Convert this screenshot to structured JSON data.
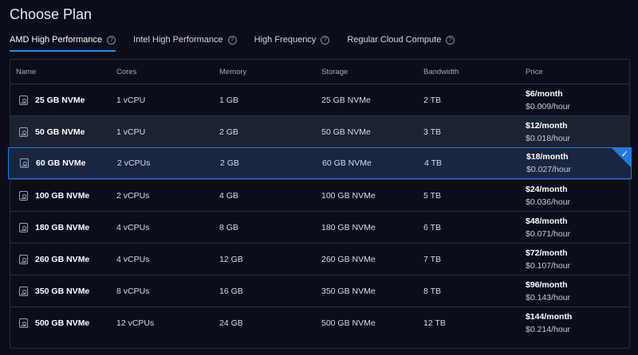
{
  "page_title": "Choose Plan",
  "tabs": [
    {
      "label": "AMD High Performance",
      "active": true
    },
    {
      "label": "Intel High Performance",
      "active": false
    },
    {
      "label": "High Frequency",
      "active": false
    },
    {
      "label": "Regular Cloud Compute",
      "active": false
    }
  ],
  "help_glyph": "?",
  "columns": {
    "name": "Name",
    "cores": "Cores",
    "memory": "Memory",
    "storage": "Storage",
    "bandwidth": "Bandwidth",
    "price": "Price"
  },
  "plans": [
    {
      "name": "25 GB NVMe",
      "cores": "1 vCPU",
      "memory": "1 GB",
      "storage": "25 GB NVMe",
      "bandwidth": "2 TB",
      "price_month": "$6/month",
      "price_hour": "$0.009/hour"
    },
    {
      "name": "50 GB NVMe",
      "cores": "1 vCPU",
      "memory": "2 GB",
      "storage": "50 GB NVMe",
      "bandwidth": "3 TB",
      "price_month": "$12/month",
      "price_hour": "$0.018/hour"
    },
    {
      "name": "60 GB NVMe",
      "cores": "2 vCPUs",
      "memory": "2 GB",
      "storage": "60 GB NVMe",
      "bandwidth": "4 TB",
      "price_month": "$18/month",
      "price_hour": "$0.027/hour"
    },
    {
      "name": "100 GB NVMe",
      "cores": "2 vCPUs",
      "memory": "4 GB",
      "storage": "100 GB NVMe",
      "bandwidth": "5 TB",
      "price_month": "$24/month",
      "price_hour": "$0.036/hour"
    },
    {
      "name": "180 GB NVMe",
      "cores": "4 vCPUs",
      "memory": "8 GB",
      "storage": "180 GB NVMe",
      "bandwidth": "6 TB",
      "price_month": "$48/month",
      "price_hour": "$0.071/hour"
    },
    {
      "name": "260 GB NVMe",
      "cores": "4 vCPUs",
      "memory": "12 GB",
      "storage": "260 GB NVMe",
      "bandwidth": "7 TB",
      "price_month": "$72/month",
      "price_hour": "$0.107/hour"
    },
    {
      "name": "350 GB NVMe",
      "cores": "8 vCPUs",
      "memory": "16 GB",
      "storage": "350 GB NVMe",
      "bandwidth": "8 TB",
      "price_month": "$96/month",
      "price_hour": "$0.143/hour"
    },
    {
      "name": "500 GB NVMe",
      "cores": "12 vCPUs",
      "memory": "24 GB",
      "storage": "500 GB NVMe",
      "bandwidth": "12 TB",
      "price_month": "$144/month",
      "price_hour": "$0.214/hour"
    }
  ],
  "hovered_index": 1,
  "selected_index": 2,
  "icons": {
    "plan": "disk-icon",
    "selected": "check-icon",
    "help": "help-circle-icon"
  },
  "colors": {
    "accent": "#1f7be3",
    "background": "#0b0e1a",
    "selected_bg": "#1a2640"
  }
}
